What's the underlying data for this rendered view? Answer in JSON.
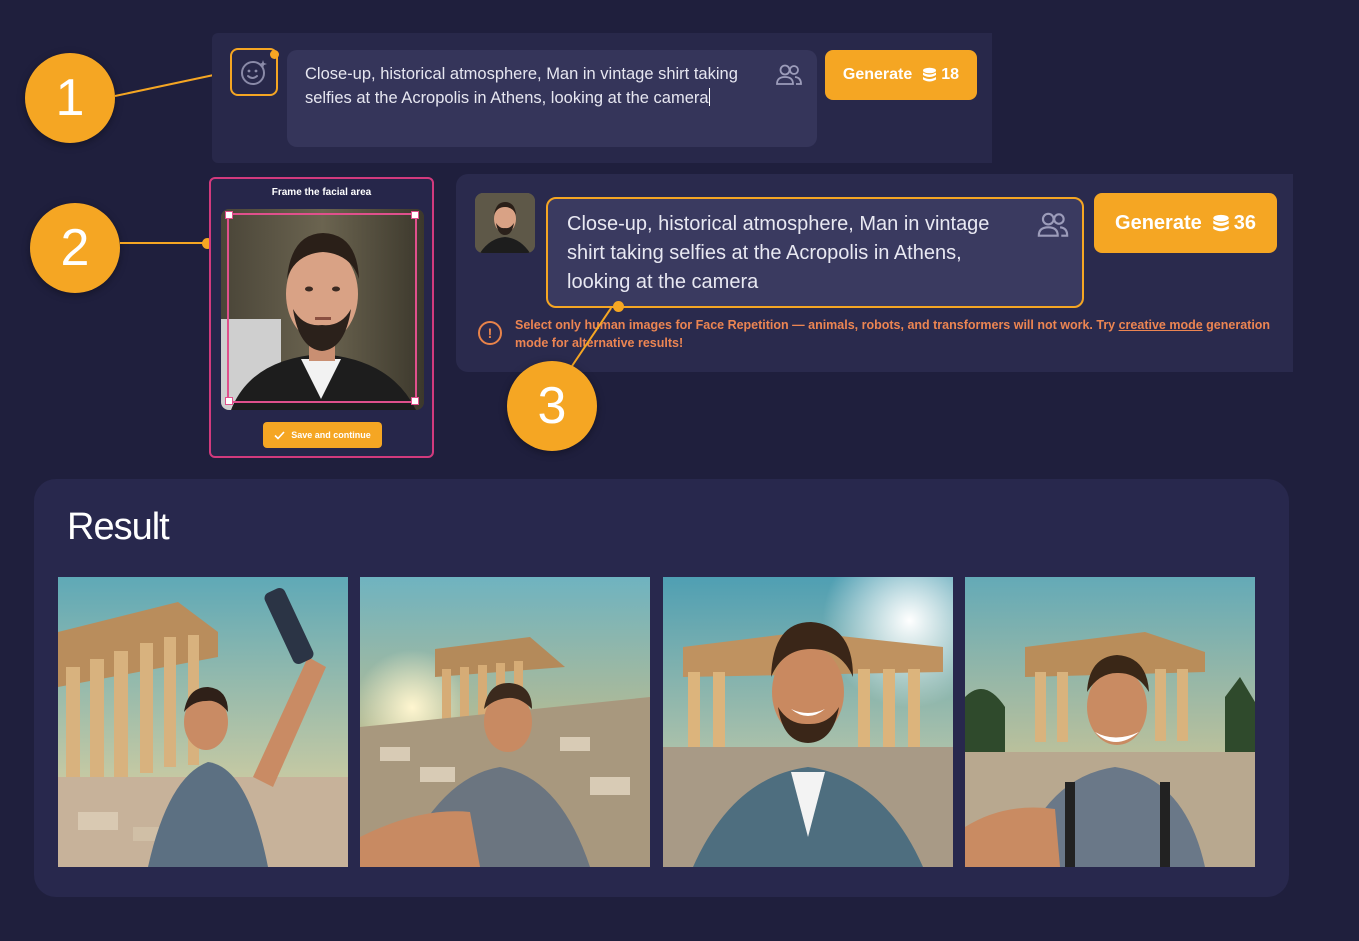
{
  "steps": [
    "1",
    "2",
    "3"
  ],
  "panel1": {
    "prompt": "Close-up, historical atmosphere, Man in vintage shirt taking selfies at the Acropolis in Athens, looking at the camera",
    "generate_label": "Generate",
    "cost": "18",
    "icons": [
      "face-sparkle-icon",
      "people-icon",
      "coin-stack-icon"
    ]
  },
  "frame_panel": {
    "title": "Frame the facial area",
    "save_label": "Save and continue",
    "icons": [
      "check-icon"
    ]
  },
  "panel3": {
    "prompt": "Close-up, historical atmosphere, Man in vintage shirt taking selfies at the Acropolis in Athens, looking at the camera",
    "generate_label": "Generate",
    "cost": "36",
    "warning_text": "Select only human images for Face Repetition — animals, robots, and transformers will not work. Try ",
    "warning_link": "creative mode",
    "warning_tail": " generation mode for alternative results!",
    "icons": [
      "warning-icon",
      "people-icon",
      "coin-stack-icon"
    ]
  },
  "result": {
    "title": "Result",
    "images": [
      "result-image-1",
      "result-image-2",
      "result-image-3",
      "result-image-4"
    ]
  },
  "colors": {
    "background": "#1f1f3d",
    "accent": "#f5a623",
    "frame_border": "#d23a7d",
    "warning": "#ec8552"
  }
}
